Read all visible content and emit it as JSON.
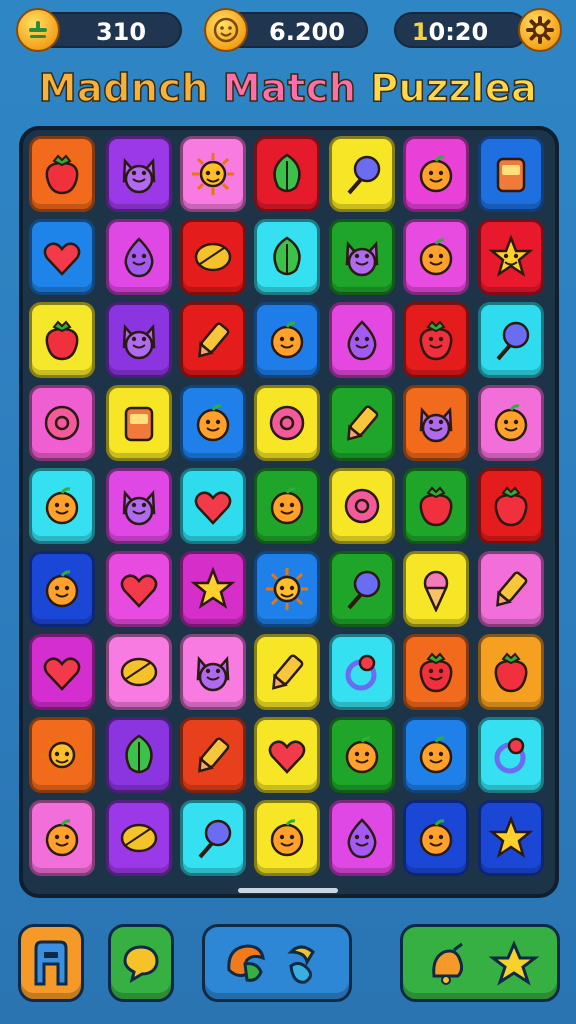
{
  "hud": {
    "score": "310",
    "coins": "6.200",
    "timer_prefix": "1",
    "timer_rest": "0:20"
  },
  "title": {
    "word1": "Madnch",
    "word2": "Match",
    "word3": "Puzzlea"
  },
  "board": {
    "rows": [
      [
        {
          "color": "#f26a1b",
          "icon": "tomato-icon"
        },
        {
          "color": "#9b39e8",
          "icon": "cat-creature-icon"
        },
        {
          "color": "#f77be0",
          "icon": "sun-icon"
        },
        {
          "color": "#e51b2c",
          "icon": "leaf-icon"
        },
        {
          "color": "#f6e626",
          "icon": "lollipop-face-icon"
        },
        {
          "color": "#e941d8",
          "icon": "lime-face-icon"
        },
        {
          "color": "#1e6fe0",
          "icon": "juice-box-icon"
        }
      ],
      [
        {
          "color": "#1e84ea",
          "icon": "heart-icon"
        },
        {
          "color": "#e048e5",
          "icon": "balloon-face-icon"
        },
        {
          "color": "#e41c1c",
          "icon": "bean-icon"
        },
        {
          "color": "#35e0f0",
          "icon": "broccoli-icon"
        },
        {
          "color": "#1fa52a",
          "icon": "bunny-face-icon"
        },
        {
          "color": "#e84be0",
          "icon": "lemon-face-icon"
        },
        {
          "color": "#e8192c",
          "icon": "star-face-icon"
        }
      ],
      [
        {
          "color": "#f5e82a",
          "icon": "strawberry-icon"
        },
        {
          "color": "#8a35e0",
          "icon": "pig-face-icon"
        },
        {
          "color": "#e41c1c",
          "icon": "crayon-icon"
        },
        {
          "color": "#1e7de8",
          "icon": "orange-face-icon"
        },
        {
          "color": "#e448e0",
          "icon": "purple-drop-icon"
        },
        {
          "color": "#e41c1c",
          "icon": "apple-face-icon"
        },
        {
          "color": "#2fdcee",
          "icon": "magnifier-icon"
        }
      ],
      [
        {
          "color": "#f05fd2",
          "icon": "donut-icon"
        },
        {
          "color": "#f6e626",
          "icon": "robot-face-icon"
        },
        {
          "color": "#1e80e8",
          "icon": "orange-face-icon"
        },
        {
          "color": "#f6e626",
          "icon": "planet-icon"
        },
        {
          "color": "#1fa52a",
          "icon": "pencil-icon"
        },
        {
          "color": "#f26a1b",
          "icon": "monster-face-icon"
        },
        {
          "color": "#f26fd9",
          "icon": "lemon-face-icon"
        }
      ],
      [
        {
          "color": "#35e0f0",
          "icon": "orange-face-icon"
        },
        {
          "color": "#e048e5",
          "icon": "cat-face-icon"
        },
        {
          "color": "#2fdcee",
          "icon": "heart-lollipop-icon"
        },
        {
          "color": "#1fa52a",
          "icon": "lemon-face-icon"
        },
        {
          "color": "#f6e626",
          "icon": "striped-ball-icon"
        },
        {
          "color": "#1fa52a",
          "icon": "berry-icon"
        },
        {
          "color": "#e41c1c",
          "icon": "strawberry-icon"
        }
      ],
      [
        {
          "color": "#1b47d6",
          "icon": "orange-face-icon"
        },
        {
          "color": "#e84be0",
          "icon": "heart-icon"
        },
        {
          "color": "#d62ec8",
          "icon": "star-icon"
        },
        {
          "color": "#1e80e8",
          "icon": "sun-face-icon"
        },
        {
          "color": "#1fa52a",
          "icon": "lollipop-icon"
        },
        {
          "color": "#f6e626",
          "icon": "ice-cream-icon"
        },
        {
          "color": "#f26fd9",
          "icon": "pencil-icon"
        }
      ],
      [
        {
          "color": "#d52ed0",
          "icon": "heart-icon"
        },
        {
          "color": "#f77be0",
          "icon": "candy-icon"
        },
        {
          "color": "#f77be0",
          "icon": "monster-face-icon"
        },
        {
          "color": "#f6e626",
          "icon": "popsicle-icon"
        },
        {
          "color": "#35e0f0",
          "icon": "ring-icon"
        },
        {
          "color": "#f26a1b",
          "icon": "tomato-face-icon"
        },
        {
          "color": "#f5a020",
          "icon": "strawberry-icon"
        }
      ],
      [
        {
          "color": "#f26a1b",
          "icon": "sun-ring-icon"
        },
        {
          "color": "#8a35e0",
          "icon": "cactus-face-icon"
        },
        {
          "color": "#e8401c",
          "icon": "crayon-icon"
        },
        {
          "color": "#f6e626",
          "icon": "heart-icon"
        },
        {
          "color": "#1fa52a",
          "icon": "lemon-face-icon"
        },
        {
          "color": "#1e80e8",
          "icon": "orange-face-icon"
        },
        {
          "color": "#35e0f0",
          "icon": "ring-icon"
        }
      ],
      [
        {
          "color": "#f26fd9",
          "icon": "orange-face-icon"
        },
        {
          "color": "#9b39e8",
          "icon": "candy-icon"
        },
        {
          "color": "#35e0f0",
          "icon": "lollipop-icon"
        },
        {
          "color": "#f6e626",
          "icon": "orange-face-icon"
        },
        {
          "color": "#e048e5",
          "icon": "balloon-face-icon"
        },
        {
          "color": "#1b47d6",
          "icon": "lemon-icon"
        },
        {
          "color": "#1b47d6",
          "icon": "star-icon"
        }
      ]
    ]
  },
  "buttons": {
    "b1": {
      "color": "#f59a28",
      "icon": "exit-door-icon"
    },
    "b2": {
      "color": "#37b043",
      "icon": "chat-bubble-icon"
    },
    "b3": {
      "color": "#2e87d4",
      "icon": "swap-shapes-icon"
    },
    "b4": {
      "color": "#37b043",
      "icon": "bell-star-icon"
    }
  }
}
